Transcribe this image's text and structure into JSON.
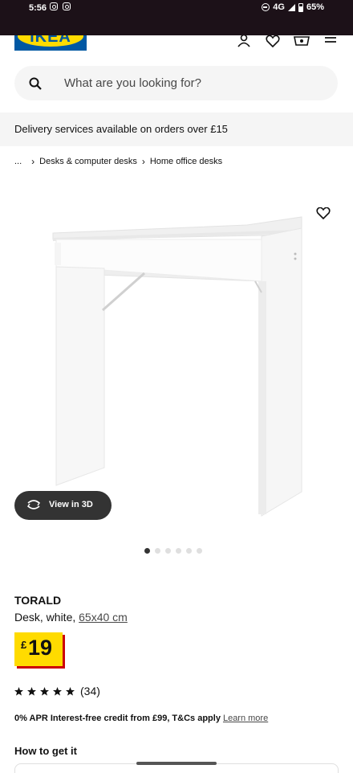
{
  "status_bar": {
    "time": "5:56",
    "network": "4G",
    "battery": "65%"
  },
  "header": {
    "logo_text": "IKEA",
    "icons": [
      "profile-icon",
      "heart-icon",
      "basket-icon",
      "menu-icon"
    ]
  },
  "search": {
    "placeholder": "What are you looking for?"
  },
  "delivery_banner": {
    "text": "Delivery services available on orders over £15"
  },
  "breadcrumb": {
    "ellipsis": "...",
    "items": [
      "Desks & computer desks",
      "Home office desks"
    ]
  },
  "gallery": {
    "view_3d_label": "View in 3D",
    "image_count": 6,
    "active_index": 0
  },
  "product": {
    "name": "TORALD",
    "description": "Desk, white, ",
    "size": "65x40 cm",
    "price_currency": "£",
    "price": "19",
    "rating_stars": 5,
    "review_count": "(34)"
  },
  "credit": {
    "text": "0% APR Interest-free credit from £99, T&Cs apply",
    "link": "Learn more"
  },
  "delivery": {
    "title": "How to get it"
  },
  "colors": {
    "ikea_blue": "#0058a3",
    "ikea_yellow": "#ffdb00",
    "price_shadow": "#cc0008"
  }
}
